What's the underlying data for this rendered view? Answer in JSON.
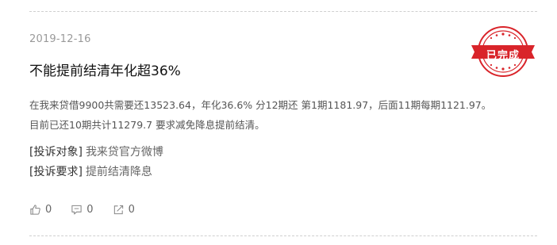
{
  "post": {
    "date": "2019-12-16",
    "title": "不能提前结清年化超36%",
    "content_lines": [
      "在我来贷借9900共需要还13523.64，年化36.6% 分12期还 第1期1181.97，后面11期每期1121.97。",
      "目前已还10期共计11279.7 要求减免降息提前结清。"
    ],
    "target_label": "[投诉对象]",
    "target_value": "我来贷官方微博",
    "request_label": "[投诉要求]",
    "request_value": "提前结清降息",
    "status_stamp": "已完成"
  },
  "actions": {
    "like_count": "0",
    "comment_count": "0",
    "share_count": "0"
  },
  "colors": {
    "stamp_red": "#d9242a",
    "divider": "#cfcfcf",
    "muted_text": "#999999"
  }
}
